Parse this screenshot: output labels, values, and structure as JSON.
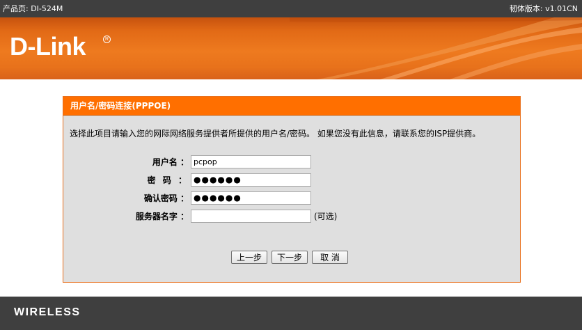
{
  "topbar": {
    "product_label": "产品页: DI-524M",
    "firmware_label": "韧体版本: v1.01CN"
  },
  "banner": {
    "logo_text": "D-Link",
    "logo_mark": "R"
  },
  "panel": {
    "title": "用户名/密码连接(PPPOE)",
    "intro": "选择此项目请输入您的网际网络服务提供者所提供的用户名/密码。 如果您没有此信息，请联系您的ISP提供商。",
    "fields": {
      "username": {
        "label": "用户名 ：",
        "value": "pcpop"
      },
      "password": {
        "label": "密  码 ：",
        "value": "●●●●●●"
      },
      "confirm_password": {
        "label": "确认密码 ：",
        "value": "●●●●●●"
      },
      "service_name": {
        "label": "服务器名字 ：",
        "value": "",
        "note": "(可选)"
      }
    },
    "buttons": {
      "prev": "上一步",
      "next": "下一步",
      "cancel": "取  消"
    }
  },
  "footer": {
    "brand": "WIRELESS"
  },
  "colors": {
    "topbar_bg": "#3f3f3f",
    "banner_orange": "#ee7a1f",
    "panel_header": "#ff6f00",
    "panel_bg": "#dfdfdf"
  }
}
